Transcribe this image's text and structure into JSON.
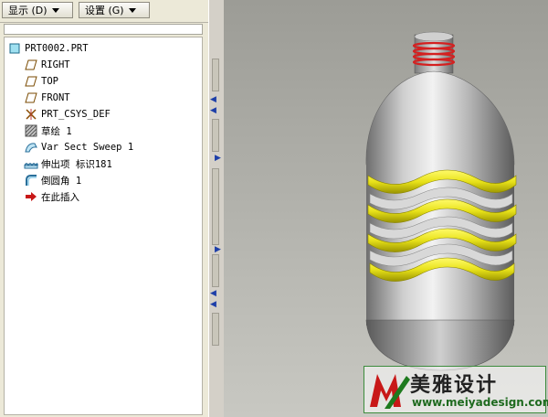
{
  "toolbar": {
    "display_label": "显示 (D)",
    "settings_label": "设置 (G)"
  },
  "tree": {
    "items": [
      {
        "label": "PRT0002.PRT",
        "icon": "part-icon"
      },
      {
        "label": "RIGHT",
        "icon": "datum-plane-icon"
      },
      {
        "label": "TOP",
        "icon": "datum-plane-icon"
      },
      {
        "label": "FRONT",
        "icon": "datum-plane-icon"
      },
      {
        "label": "PRT_CSYS_DEF",
        "icon": "coordinate-system-icon"
      },
      {
        "label": "草绘 1",
        "icon": "sketch-icon"
      },
      {
        "label": "Var Sect Sweep 1",
        "icon": "sweep-icon"
      },
      {
        "label": "伸出项 标识181",
        "icon": "protrusion-icon"
      },
      {
        "label": "倒圆角 1",
        "icon": "round-icon"
      },
      {
        "label": "在此插入",
        "icon": "insert-here-icon"
      }
    ]
  },
  "watermark": {
    "brand": "美雅设计",
    "url": "www.meiyadesign.com"
  },
  "colors": {
    "panel_bg": "#ece9d8",
    "viewport_bg": "#b0b0aa",
    "bottle_body": "#b4b4b4",
    "band_yellow": "#e8e21a",
    "thread_red": "#d42020"
  }
}
